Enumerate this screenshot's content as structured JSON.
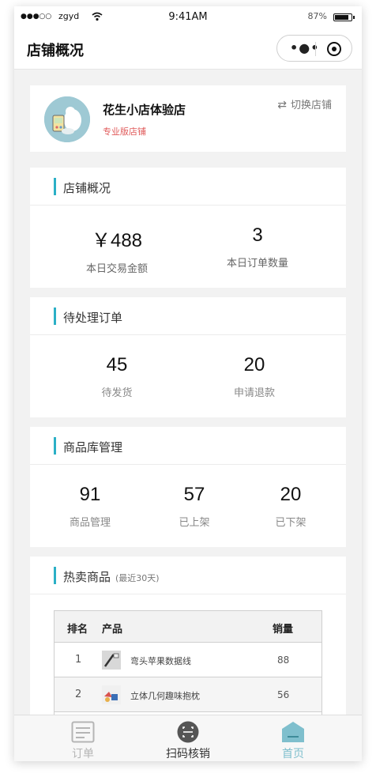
{
  "status_bar": {
    "signal": "●●●○○",
    "carrier": "zgyd",
    "time": "9:41AM",
    "battery_pct": "87%"
  },
  "nav": {
    "title": "店铺概况",
    "more_glyph": "•●•"
  },
  "store": {
    "name": "花生小店体验店",
    "level": "专业版店铺",
    "switch_label": "切换店铺",
    "switch_glyph": "⇄"
  },
  "overview": {
    "title": "店铺概况",
    "stats": [
      {
        "value": "￥488",
        "label": "本日交易金额"
      },
      {
        "value": "3",
        "label": "本日订单数量"
      }
    ]
  },
  "pending": {
    "title": "待处理订单",
    "stats": [
      {
        "value": "45",
        "label": "待发货"
      },
      {
        "value": "20",
        "label": "申请退款"
      }
    ]
  },
  "library": {
    "title": "商品库管理",
    "stats": [
      {
        "value": "91",
        "label": "商品管理"
      },
      {
        "value": "57",
        "label": "已上架"
      },
      {
        "value": "20",
        "label": "已下架"
      }
    ]
  },
  "hot": {
    "title": "热卖商品",
    "subtitle": "(最近30天)",
    "headers": {
      "rank": "排名",
      "product": "产品",
      "sales": "销量"
    },
    "rows": [
      {
        "rank": "1",
        "product": "弯头苹果数据线",
        "sales": "88"
      },
      {
        "rank": "2",
        "product": "立体几何趣味抱枕",
        "sales": "56"
      }
    ]
  },
  "tabbar": {
    "items": [
      {
        "label": "订单",
        "icon": "order-list-icon"
      },
      {
        "label": "扫码核销",
        "icon": "scan-icon"
      },
      {
        "label": "首页",
        "icon": "home-icon"
      }
    ]
  },
  "colors": {
    "accent": "#2bb0c6",
    "level_red": "#e05a5a",
    "home_active": "#7fbfcd"
  }
}
